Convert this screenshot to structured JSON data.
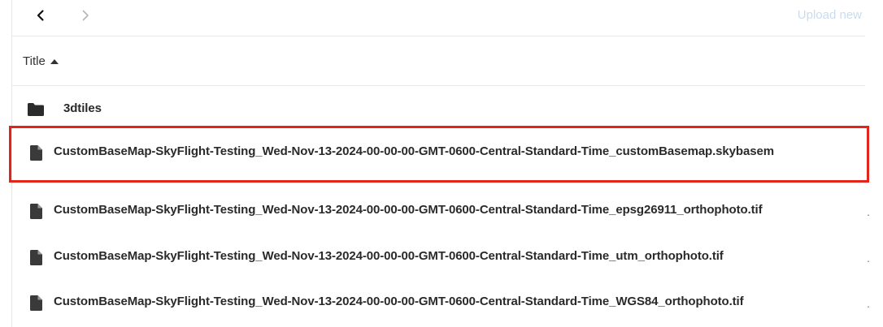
{
  "toolbar": {
    "back_icon": "chevron-left-icon",
    "forward_icon": "chevron-right-icon",
    "upload_label": "Upload new"
  },
  "table": {
    "header_title": "Title",
    "sort_icon": "caret-up-icon",
    "rows": [
      {
        "type": "folder",
        "icon": "folder-icon",
        "label": "3dtiles"
      },
      {
        "type": "file",
        "icon": "file-icon",
        "label": "CustomBaseMap-SkyFlight-Testing_Wed-Nov-13-2024-00-00-00-GMT-0600-Central-Standard-Time_customBasemap.skybasem",
        "highlighted": true
      },
      {
        "type": "file",
        "icon": "file-icon",
        "label": "CustomBaseMap-SkyFlight-Testing_Wed-Nov-13-2024-00-00-00-GMT-0600-Central-Standard-Time_epsg26911_orthophoto.tif"
      },
      {
        "type": "file",
        "icon": "file-icon",
        "label": "CustomBaseMap-SkyFlight-Testing_Wed-Nov-13-2024-00-00-00-GMT-0600-Central-Standard-Time_utm_orthophoto.tif"
      },
      {
        "type": "file",
        "icon": "file-icon",
        "label": "CustomBaseMap-SkyFlight-Testing_Wed-Nov-13-2024-00-00-00-GMT-0600-Central-Standard-Time_WGS84_orthophoto.tif"
      }
    ]
  },
  "colors": {
    "highlight_border": "#e1251b",
    "upload_link": "#c9dcef"
  }
}
